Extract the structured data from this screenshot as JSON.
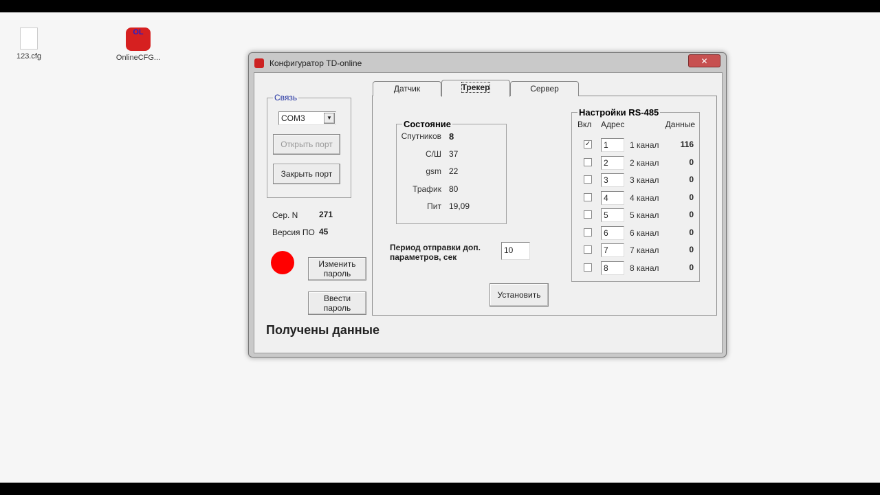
{
  "desktop": {
    "icons": [
      {
        "label": "123.cfg",
        "icon": "file-icon"
      },
      {
        "label": "OnlineCFG...",
        "icon": "app-icon"
      }
    ]
  },
  "window": {
    "title": "Конфигуратор TD-online",
    "close": "✕"
  },
  "connection": {
    "legend": "Связь",
    "port": "COM3",
    "open_port": "Открыть порт",
    "close_port": "Закрыть порт"
  },
  "device": {
    "serial_label": "Сер. N",
    "serial": "271",
    "version_label": "Версия ПО",
    "version": "45",
    "status_color": "#ff0000",
    "change_password": [
      "Изменить",
      "пароль"
    ],
    "enter_password": [
      "Ввести",
      "пароль"
    ]
  },
  "status_text": "Получены данные",
  "tabs": [
    {
      "label": "Датчик"
    },
    {
      "label": "Трекер",
      "active": true
    },
    {
      "label": "Сервер"
    }
  ],
  "state": {
    "legend": "Состояние",
    "rows": [
      {
        "label": "Спутников",
        "value": "8"
      },
      {
        "label": "С/Ш",
        "value": "37"
      },
      {
        "label": "gsm",
        "value": "22"
      },
      {
        "label": "Трафик",
        "value": "80"
      },
      {
        "label": "Пит",
        "value": "19,09"
      }
    ]
  },
  "period": {
    "label1": "Период отправки  доп.",
    "label2": "параметров, сек",
    "value": "10"
  },
  "set_button": "Установить",
  "rs485": {
    "legend": "Настройки RS-485",
    "col_on": "Вкл",
    "col_addr": "Адрес",
    "col_data": "Данные",
    "check_mark": "✓",
    "channels": [
      {
        "on": true,
        "addr": "1",
        "name": "1 канал",
        "data": "116"
      },
      {
        "on": false,
        "addr": "2",
        "name": "2 канал",
        "data": "0"
      },
      {
        "on": false,
        "addr": "3",
        "name": "3 канал",
        "data": "0"
      },
      {
        "on": false,
        "addr": "4",
        "name": "4 канал",
        "data": "0"
      },
      {
        "on": false,
        "addr": "5",
        "name": "5 канал",
        "data": "0"
      },
      {
        "on": false,
        "addr": "6",
        "name": "6 канал",
        "data": "0"
      },
      {
        "on": false,
        "addr": "7",
        "name": "7 канал",
        "data": "0"
      },
      {
        "on": false,
        "addr": "8",
        "name": "8 канал",
        "data": "0"
      }
    ]
  }
}
